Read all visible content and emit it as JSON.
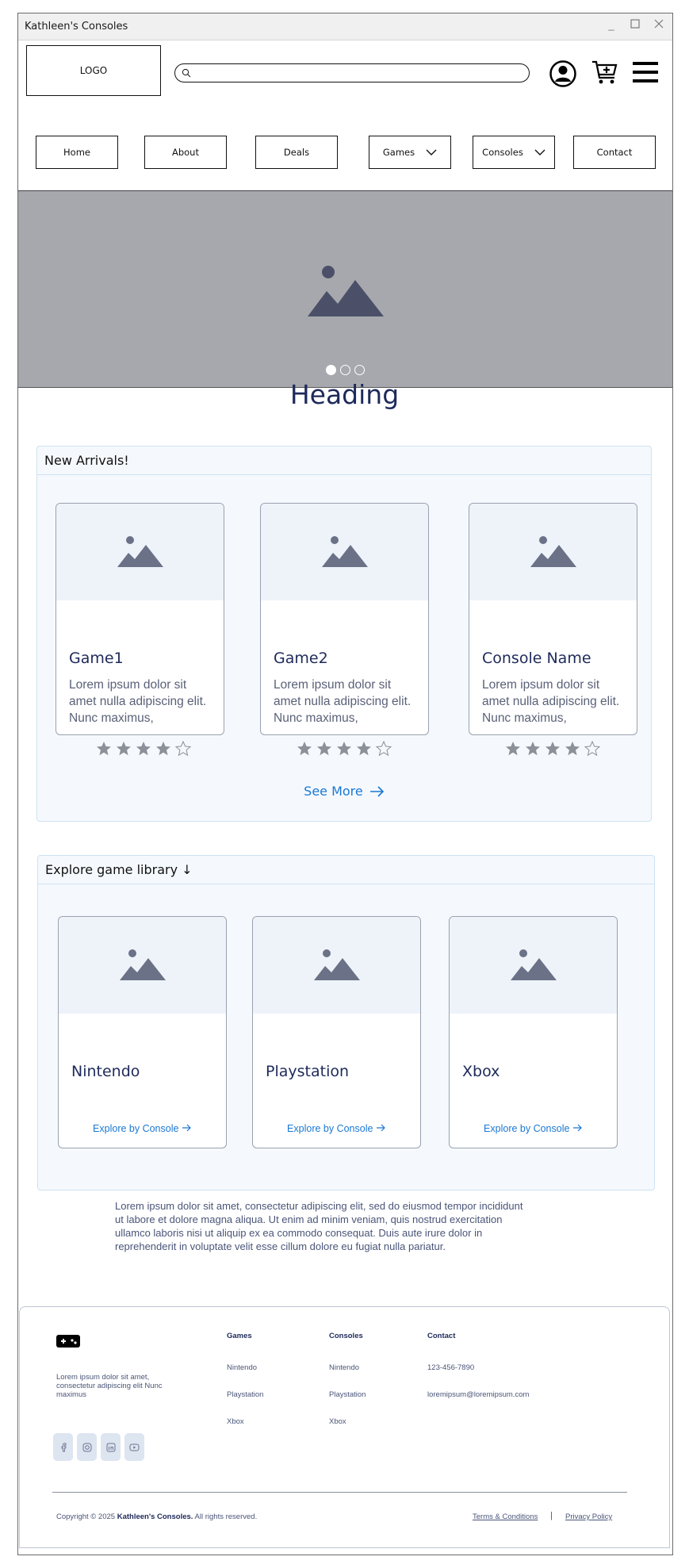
{
  "window": {
    "title": "Kathleen's Consoles"
  },
  "header": {
    "logo": "LOGO",
    "search_placeholder": ""
  },
  "nav": {
    "items": [
      {
        "label": "Home"
      },
      {
        "label": "About"
      },
      {
        "label": "Deals"
      },
      {
        "label": "Games"
      },
      {
        "label": "Consoles"
      },
      {
        "label": "Contact"
      }
    ]
  },
  "hero": {
    "slide_count": 3,
    "active_slide": 1
  },
  "main": {
    "heading": "Heading"
  },
  "arrivals": {
    "title": "New Arrivals!",
    "cards": [
      {
        "title": "Game1",
        "desc": "Lorem ipsum dolor sit amet nulla adipiscing elit. Nunc maximus,",
        "rating": 4
      },
      {
        "title": "Game2",
        "desc": "Lorem ipsum dolor sit amet nulla adipiscing elit. Nunc maximus,",
        "rating": 4
      },
      {
        "title": "Console Name",
        "desc": "Lorem ipsum dolor sit amet nulla adipiscing elit. Nunc maximus,",
        "rating": 4
      }
    ],
    "see_more": "See More"
  },
  "library": {
    "title": "Explore game library ↓",
    "cards": [
      {
        "title": "Nintendo",
        "link": "Explore by Console"
      },
      {
        "title": "Playstation",
        "link": "Explore by Console"
      },
      {
        "title": "Xbox",
        "link": "Explore by Console"
      }
    ]
  },
  "lorem": "Lorem ipsum dolor sit amet, consectetur adipiscing elit, sed do eiusmod tempor incididunt ut labore et dolore magna aliqua. Ut enim ad minim veniam, quis nostrud exercitation ullamco laboris nisi ut aliquip ex ea commodo consequat. Duis aute irure dolor in reprehenderit in voluptate velit esse cillum dolore eu fugiat nulla pariatur.",
  "footer": {
    "about": "Lorem ipsum dolor sit amet, consectetur adipiscing elit Nunc maximus",
    "games": {
      "heading": "Games",
      "items": [
        "Nintendo",
        "Playstation",
        "Xbox"
      ]
    },
    "consoles": {
      "heading": "Consoles",
      "items": [
        "Nintendo",
        "Playstation",
        "Xbox"
      ]
    },
    "contact": {
      "heading": "Contact",
      "phone": "123-456-7890",
      "email": "loremipsum@loremipsum.com"
    },
    "copyright_prefix": "Copyright © 2025",
    "brand": "Kathleen's Consoles.",
    "copyright_suffix": "All rights reserved.",
    "terms": "Terms & Conditions",
    "separator": "|",
    "privacy": "Privacy Policy",
    "social": [
      "facebook-icon",
      "instagram-icon",
      "linkedin-icon",
      "youtube-icon"
    ]
  },
  "colors": {
    "accent": "#1a78d4",
    "navy": "#1e2a5a",
    "panel_bg": "#f5f9fd",
    "hero_bg": "#a6a8ad"
  }
}
